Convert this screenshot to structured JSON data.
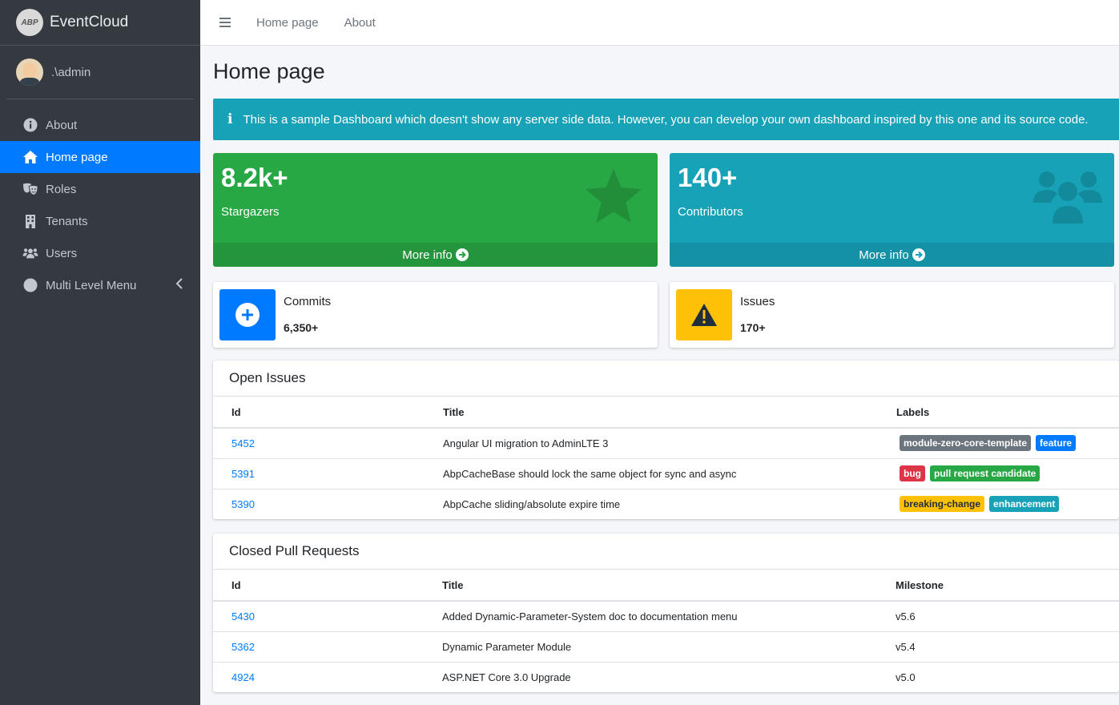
{
  "brand": {
    "name": "EventCloud",
    "logo_text": "ABP"
  },
  "user": {
    "name": ".\\admin"
  },
  "sidebar": {
    "items": [
      {
        "label": "About",
        "icon": "info-circle-icon"
      },
      {
        "label": "Home page",
        "icon": "home-icon",
        "active": true
      },
      {
        "label": "Roles",
        "icon": "theater-masks-icon"
      },
      {
        "label": "Tenants",
        "icon": "building-icon"
      },
      {
        "label": "Users",
        "icon": "users-icon"
      },
      {
        "label": "Multi Level Menu",
        "icon": "circle-icon"
      }
    ]
  },
  "topbar": {
    "links": [
      "Home page",
      "About"
    ]
  },
  "page": {
    "title": "Home page"
  },
  "callout": {
    "icon": "info-icon",
    "text": "This is a sample Dashboard which doesn't show any server side data. However, you can develop your own dashboard inspired by this one and its source code."
  },
  "stats": [
    {
      "value": "8.2k+",
      "label": "Stargazers",
      "more": "More info",
      "color": "#28a745",
      "icon": "star-icon"
    },
    {
      "value": "140+",
      "label": "Contributors",
      "more": "More info",
      "color": "#17a2b8",
      "icon": "users-icon"
    }
  ],
  "info_boxes": [
    {
      "label": "Commits",
      "value": "6,350+",
      "color": "#007bff",
      "icon": "plus-circle-icon"
    },
    {
      "label": "Issues",
      "value": "170+",
      "color": "#ffc107",
      "icon": "warning-icon"
    }
  ],
  "open_issues": {
    "title": "Open Issues",
    "columns": [
      "Id",
      "Title",
      "Labels"
    ],
    "rows": [
      {
        "id": "5452",
        "title": "Angular UI migration to AdminLTE 3",
        "labels": [
          "module-zero-core-template",
          "feature"
        ]
      },
      {
        "id": "5391",
        "title": "AbpCacheBase should lock the same object for sync and async",
        "labels": [
          "bug",
          "pull request candidate"
        ]
      },
      {
        "id": "5390",
        "title": "AbpCache sliding/absolute expire time",
        "labels": [
          "breaking-change",
          "enhancement"
        ]
      }
    ]
  },
  "closed_prs": {
    "title": "Closed Pull Requests",
    "columns": [
      "Id",
      "Title",
      "Milestone"
    ],
    "rows": [
      {
        "id": "5430",
        "title": "Added Dynamic-Parameter-System doc to documentation menu",
        "milestone": "v5.6"
      },
      {
        "id": "5362",
        "title": "Dynamic Parameter Module",
        "milestone": "v5.4"
      },
      {
        "id": "4924",
        "title": "ASP.NET Core 3.0 Upgrade",
        "milestone": "v5.0"
      }
    ]
  },
  "colors": {
    "sidebar": "#343a40",
    "accent": "#007bff",
    "info": "#17a2b8",
    "success": "#28a745",
    "warning": "#ffc107",
    "danger": "#dc3545",
    "secondary": "#6c757d"
  }
}
